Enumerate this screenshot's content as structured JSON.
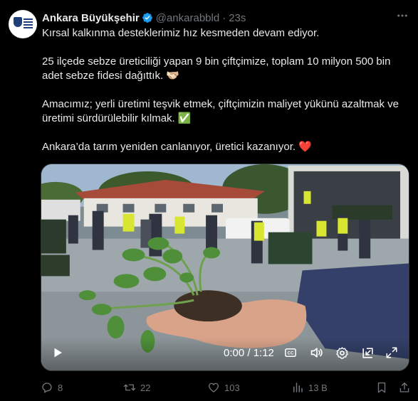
{
  "tweet": {
    "display_name": "Ankara Büyükşehir",
    "handle": "@ankarabbld",
    "separator": "·",
    "time": "23s",
    "lines": {
      "l1": "Kırsal kalkınma desteklerimiz hız kesmeden devam ediyor.",
      "l2": "25 ilçede sebze üreticiliği yapan 9 bin çiftçimize, toplam 10 milyon 500 bin adet sebze fidesi dağıttık. 🫱🏻‍🫲🏼",
      "l3": "Amacımız; yerli üretimi teşvik etmek, çiftçimizin maliyet yükünü azaltmak ve üretimi sürdürülebilir kılmak. ✅",
      "l4": "Ankara’da tarım yeniden canlanıyor, üretici kazanıyor. ❤️"
    }
  },
  "video": {
    "time_label": "0:00 / 1:12"
  },
  "actions": {
    "replies": "8",
    "reposts": "22",
    "likes": "103",
    "views": "13 B"
  },
  "colors": {
    "background": "#000000",
    "text": "#e7e9ea",
    "muted": "#71767b",
    "verified": "#1d9bf0"
  },
  "icons": [
    "verified-icon",
    "more-icon",
    "play-icon",
    "captions-icon",
    "volume-icon",
    "settings-icon",
    "pip-icon",
    "fullscreen-icon",
    "reply-icon",
    "repost-icon",
    "like-icon",
    "views-icon",
    "bookmark-icon",
    "share-icon"
  ]
}
